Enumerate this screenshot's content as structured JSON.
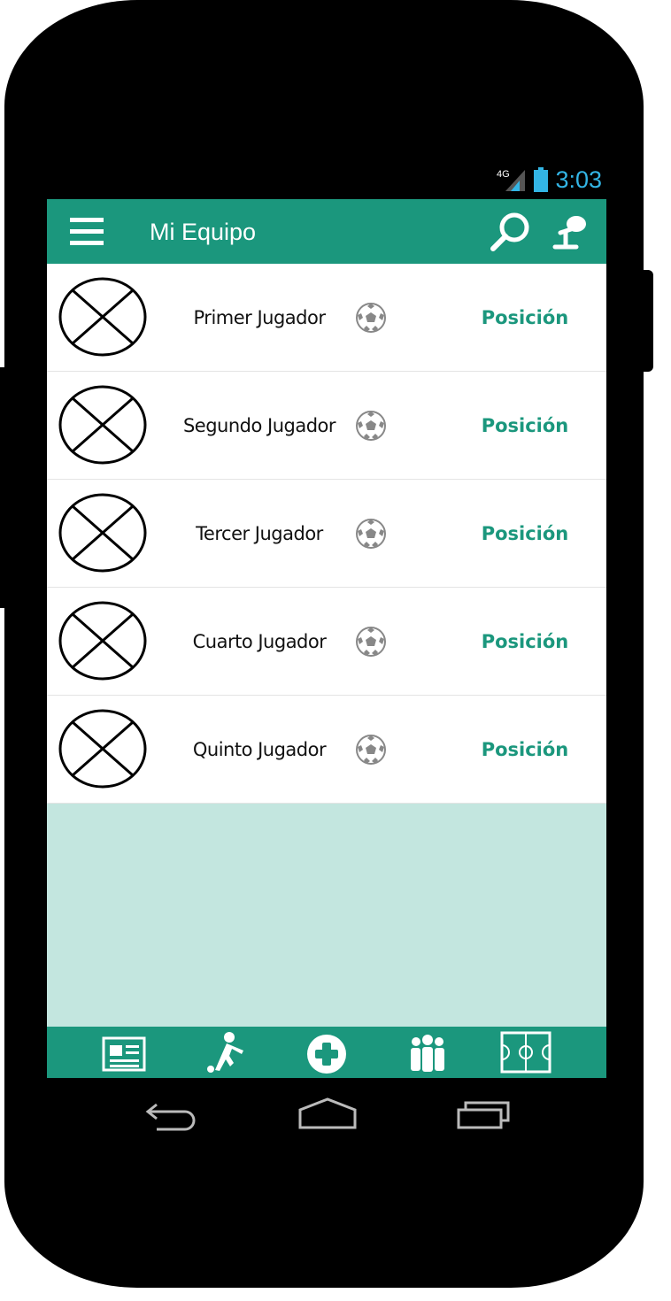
{
  "status_bar": {
    "network": "4G",
    "time": "3:03"
  },
  "app_bar": {
    "title": "Mi Equipo",
    "menu_icon": "hamburger-menu-icon",
    "search_icon": "search-icon",
    "pin_icon": "pin-icon"
  },
  "players": [
    {
      "name": "Primer Jugador",
      "position": "Posición"
    },
    {
      "name": "Segundo Jugador",
      "position": "Posición"
    },
    {
      "name": "Tercer Jugador",
      "position": "Posición"
    },
    {
      "name": "Cuarto Jugador",
      "position": "Posición"
    },
    {
      "name": "Quinto Jugador",
      "position": "Posición"
    }
  ],
  "bottom_nav": [
    {
      "icon": "newspaper-icon"
    },
    {
      "icon": "player-kick-icon"
    },
    {
      "icon": "add-circle-icon"
    },
    {
      "icon": "team-group-icon"
    },
    {
      "icon": "soccer-field-icon"
    }
  ],
  "system_nav": [
    "back-icon",
    "home-icon",
    "recents-icon"
  ],
  "colors": {
    "primary": "#1b977d",
    "background": "#c3e6df",
    "time": "#33b5e5"
  }
}
